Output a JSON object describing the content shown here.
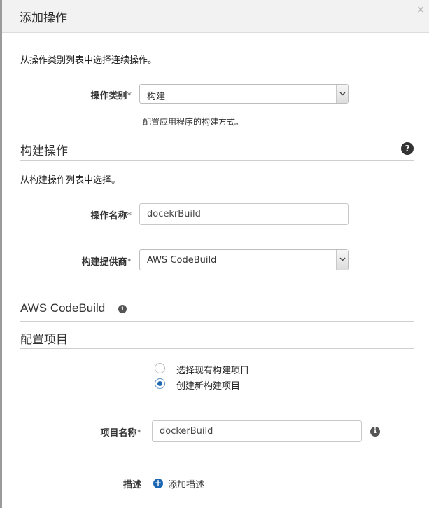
{
  "dialog": {
    "title": "添加操作",
    "close_glyph": "×"
  },
  "action_category": {
    "intro": "从操作类别列表中选择连续操作。",
    "label": "操作类别",
    "required_mark": "*",
    "selected": "构建",
    "help_text": "配置应用程序的构建方式。"
  },
  "build_action": {
    "section_title": "构建操作",
    "help_icon_glyph": "?",
    "intro": "从构建操作列表中选择。",
    "action_name_label": "操作名称",
    "action_name_value": "docekrBuild",
    "provider_label": "构建提供商",
    "provider_selected": "AWS CodeBuild",
    "required_mark": "*"
  },
  "codebuild": {
    "section_title": "AWS CodeBuild",
    "info_glyph": "i"
  },
  "configure_project": {
    "section_title": "配置项目",
    "options": [
      {
        "label": "选择现有构建项目",
        "checked": false
      },
      {
        "label": "创建新构建项目",
        "checked": true
      }
    ],
    "project_name_label": "项目名称",
    "project_name_value": "dockerBuild",
    "required_mark": "*",
    "info_glyph": "i",
    "description_label": "描述",
    "add_description_label": "添加描述",
    "plus_glyph": "+"
  }
}
